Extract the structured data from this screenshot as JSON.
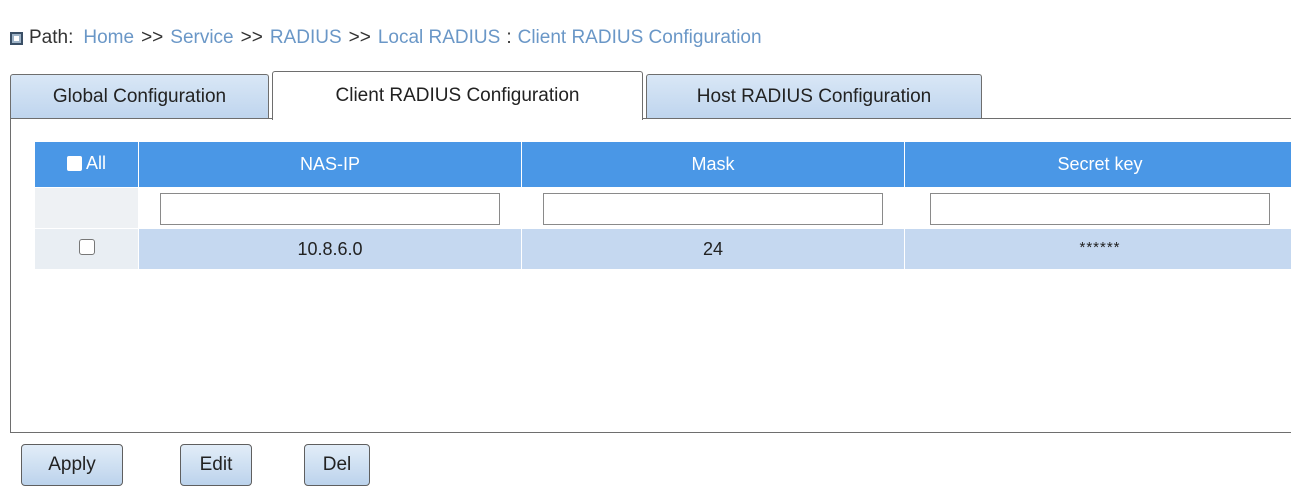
{
  "breadcrumb": {
    "label": "Path:",
    "items": [
      "Home",
      "Service",
      "RADIUS",
      "Local RADIUS"
    ],
    "separator": ">>",
    "colon": ":",
    "current": "Client RADIUS Configuration"
  },
  "tabs": [
    {
      "label": "Global Configuration",
      "active": false
    },
    {
      "label": "Client RADIUS Configuration",
      "active": true
    },
    {
      "label": "Host RADIUS Configuration",
      "active": false
    }
  ],
  "table": {
    "select_all_label": "All",
    "columns": [
      "NAS-IP",
      "Mask",
      "Secret key"
    ],
    "filters": {
      "nas_ip": "",
      "mask": "",
      "secret_key": ""
    },
    "rows": [
      {
        "nas_ip": "10.8.6.0",
        "mask": "24",
        "secret_key": "******"
      }
    ]
  },
  "buttons": {
    "apply": "Apply",
    "edit": "Edit",
    "del": "Del"
  },
  "colors": {
    "header_bg": "#4a97e6",
    "row_bg": "#c5d8f0",
    "link": "#6a97c7",
    "tab_inactive": "#bfd5ee"
  },
  "icons": {
    "path": "path-square-icon"
  }
}
